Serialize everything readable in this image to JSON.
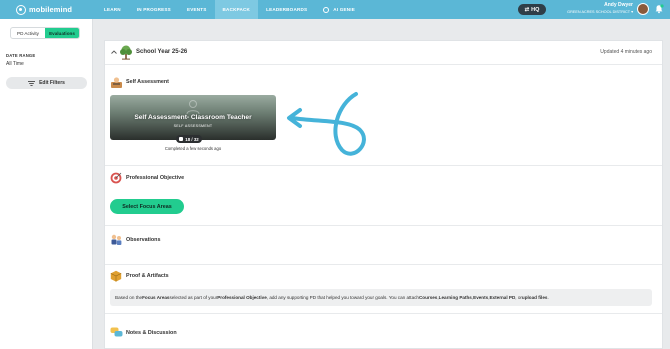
{
  "app": {
    "logo_text": "mobilemind"
  },
  "nav": {
    "items": [
      {
        "label": "LEARN",
        "active": false
      },
      {
        "label": "IN PROGRESS",
        "active": false
      },
      {
        "label": "EVENTS",
        "active": false
      },
      {
        "label": "BACKPACK",
        "active": true
      },
      {
        "label": "LEADERBOARDS",
        "active": false
      },
      {
        "label": "AI GENIE",
        "active": false,
        "icon": "gear-icon"
      }
    ],
    "hq_label": "HQ",
    "user_name": "Andy Dwyer",
    "user_district": "GREEN ACRES SCHOOL DISTRICT"
  },
  "sidebar": {
    "toggle": [
      "PD Activity",
      "Evaluations"
    ],
    "toggle_active": "Evaluations",
    "date_range_label": "DATE RANGE",
    "date_range_value": "All Time",
    "edit_filters_label": "Edit Filters"
  },
  "main": {
    "school_year": "School Year 25-26",
    "updated": "Updated 4 minutes ago",
    "sections": {
      "self_assessment": {
        "title": "Self Assessment",
        "tile_title": "Self Assessment- Classroom Teacher",
        "tile_subtitle": "SELF ASSESSMENT",
        "progress": "18 / 32",
        "completed": "Completed a few seconds ago"
      },
      "professional_objective": {
        "title": "Professional Objective",
        "button_label": "Select Focus Areas"
      },
      "observations": {
        "title": "Observations"
      },
      "proof": {
        "title": "Proof & Artifacts",
        "text_parts": [
          "Based on the ",
          "Focus Areas",
          " selected as part of your ",
          "Professional Objective",
          ", add any supporting PD that helped you toward your goals. You can attach ",
          "Courses",
          ", ",
          "Learning Paths",
          ", ",
          "Events",
          ", ",
          "External PD",
          ", or ",
          "upload files",
          "."
        ]
      },
      "notes": {
        "title": "Notes & Discussion"
      }
    }
  },
  "colors": {
    "nav": "#5bb7d6",
    "accent_green": "#22cc8f",
    "arrow": "#45b3d9"
  }
}
